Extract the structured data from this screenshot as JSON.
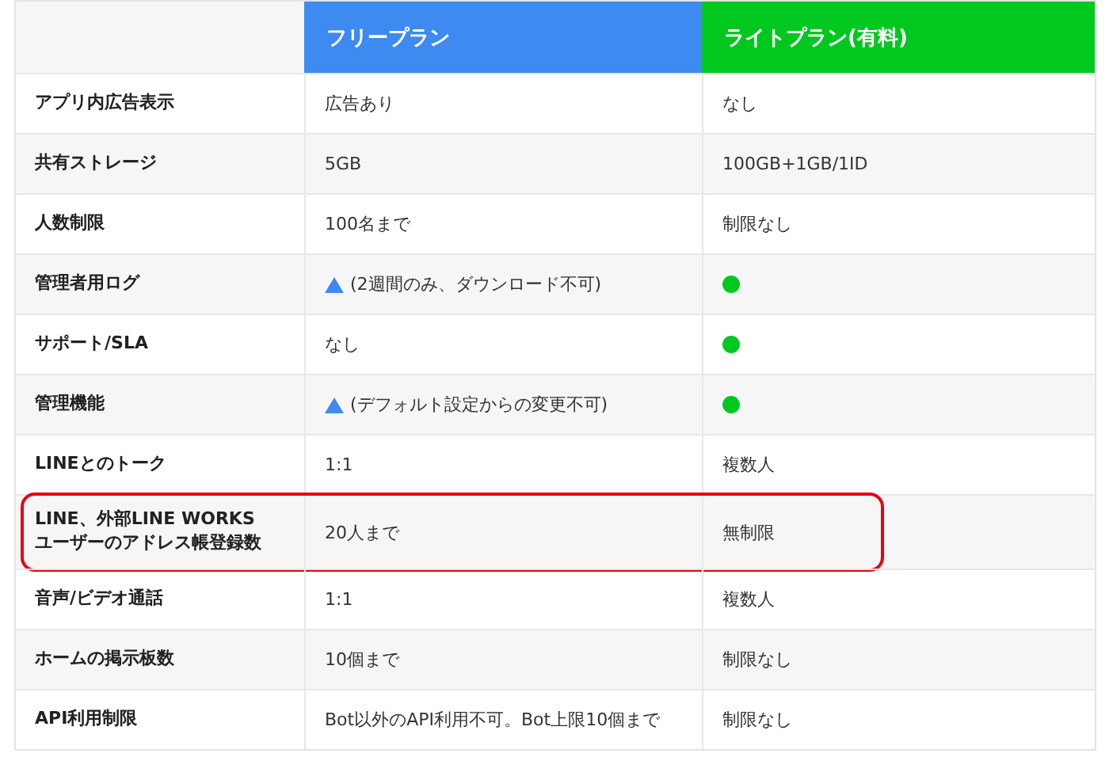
{
  "table": {
    "columns": [
      {
        "label": "フリープラン",
        "color": "#3d8af0"
      },
      {
        "label": "ライトプラン(有料)",
        "color": "#00c81e"
      }
    ],
    "rows": [
      {
        "label": "アプリ内広告表示",
        "highlighted": false,
        "cells": [
          {
            "kind": "text",
            "text": "広告あり"
          },
          {
            "kind": "text",
            "text": "なし"
          }
        ]
      },
      {
        "label": "共有ストレージ",
        "highlighted": false,
        "cells": [
          {
            "kind": "text",
            "text": "5GB"
          },
          {
            "kind": "text",
            "text": "100GB+1GB/1ID"
          }
        ]
      },
      {
        "label": "人数制限",
        "highlighted": false,
        "cells": [
          {
            "kind": "text",
            "text": "100名まで"
          },
          {
            "kind": "text",
            "text": "制限なし"
          }
        ]
      },
      {
        "label": "管理者用ログ",
        "highlighted": false,
        "cells": [
          {
            "kind": "partial",
            "text": "(2週間のみ、ダウンロード不可)"
          },
          {
            "kind": "dot"
          }
        ]
      },
      {
        "label": "サポート/SLA",
        "highlighted": false,
        "cells": [
          {
            "kind": "text",
            "text": "なし"
          },
          {
            "kind": "dot"
          }
        ]
      },
      {
        "label": "管理機能",
        "highlighted": false,
        "cells": [
          {
            "kind": "partial",
            "text": "(デフォルト設定からの変更不可)"
          },
          {
            "kind": "dot"
          }
        ]
      },
      {
        "label": "LINEとのトーク",
        "highlighted": false,
        "cells": [
          {
            "kind": "text",
            "text": "1:1"
          },
          {
            "kind": "text",
            "text": "複数人"
          }
        ]
      },
      {
        "label": "LINE、外部LINE WORKS\nユーザーのアドレス帳登録数",
        "highlighted": true,
        "cells": [
          {
            "kind": "text",
            "text": "20人まで"
          },
          {
            "kind": "text",
            "text": "無制限"
          }
        ]
      },
      {
        "label": "音声/ビデオ通話",
        "highlighted": false,
        "cells": [
          {
            "kind": "text",
            "text": "1:1"
          },
          {
            "kind": "text",
            "text": "複数人"
          }
        ]
      },
      {
        "label": "ホームの掲示板数",
        "highlighted": false,
        "cells": [
          {
            "kind": "text",
            "text": "10個まで"
          },
          {
            "kind": "text",
            "text": "制限なし"
          }
        ]
      },
      {
        "label": "API利用制限",
        "highlighted": false,
        "cells": [
          {
            "kind": "text",
            "text": "Bot以外のAPI利用不可。Bot上限10個まで"
          },
          {
            "kind": "text",
            "text": "制限なし"
          }
        ]
      }
    ]
  }
}
